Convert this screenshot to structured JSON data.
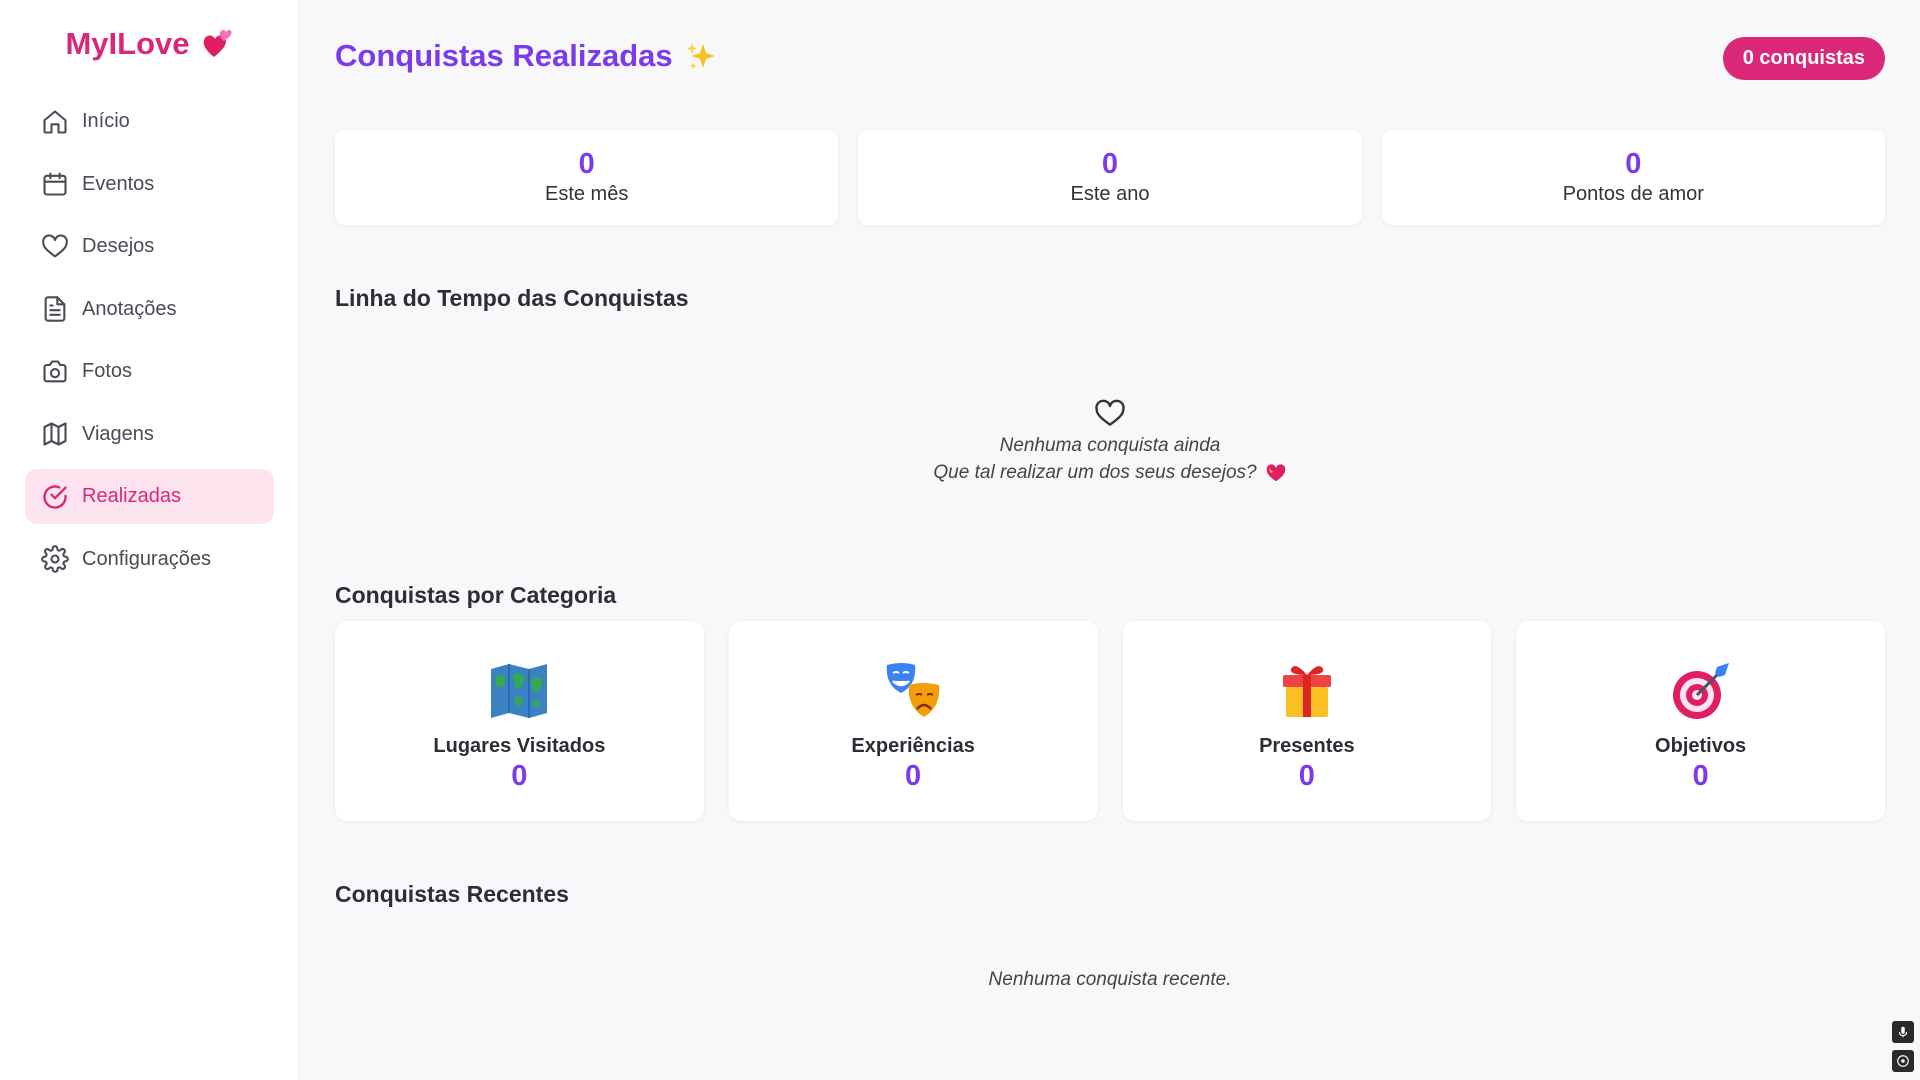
{
  "app": {
    "name": "MyILove"
  },
  "sidebar": {
    "items": [
      {
        "label": "Início",
        "icon": "home-icon",
        "active": false
      },
      {
        "label": "Eventos",
        "icon": "calendar-icon",
        "active": false
      },
      {
        "label": "Desejos",
        "icon": "heart-icon",
        "active": false
      },
      {
        "label": "Anotações",
        "icon": "document-icon",
        "active": false
      },
      {
        "label": "Fotos",
        "icon": "camera-icon",
        "active": false
      },
      {
        "label": "Viagens",
        "icon": "map-icon",
        "active": false
      },
      {
        "label": "Realizadas",
        "icon": "check-circle-icon",
        "active": true
      },
      {
        "label": "Configurações",
        "icon": "gear-icon",
        "active": false
      }
    ]
  },
  "header": {
    "title": "Conquistas Realizadas",
    "badge": "0 conquistas"
  },
  "stats": [
    {
      "value": "0",
      "label": "Este mês"
    },
    {
      "value": "0",
      "label": "Este ano"
    },
    {
      "value": "0",
      "label": "Pontos de amor"
    }
  ],
  "timeline": {
    "title": "Linha do Tempo das Conquistas",
    "empty_line1": "Nenhuma conquista ainda",
    "empty_line2": "Que tal realizar um dos seus desejos?"
  },
  "categories": {
    "title": "Conquistas por Categoria",
    "items": [
      {
        "label": "Lugares Visitados",
        "value": "0",
        "icon": "world-map-icon"
      },
      {
        "label": "Experiências",
        "value": "0",
        "icon": "theater-masks-icon"
      },
      {
        "label": "Presentes",
        "value": "0",
        "icon": "gift-icon"
      },
      {
        "label": "Objetivos",
        "value": "0",
        "icon": "target-icon"
      }
    ]
  },
  "recent": {
    "title": "Conquistas Recentes",
    "empty": "Nenhuma conquista recente."
  },
  "colors": {
    "brand": "#db2777",
    "accent": "#7c3aed",
    "active_bg": "#fde4ee"
  }
}
